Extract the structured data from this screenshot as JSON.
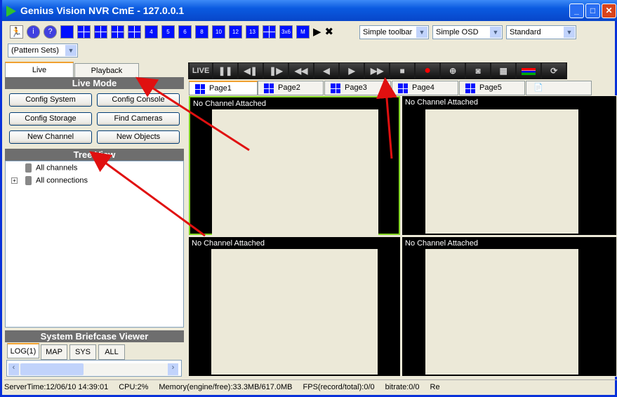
{
  "window": {
    "title": "Genius Vision NVR CmE - 127.0.0.1",
    "min": "_",
    "max": "□",
    "close": "✕"
  },
  "toolbar": {
    "icons": [
      "exit-icon",
      "info-icon",
      "help-icon",
      "layout-1",
      "layout-4",
      "layout-9",
      "layout-16",
      "layout-25",
      "layout-4-plus",
      "layout-5",
      "layout-6",
      "layout-8",
      "layout-10",
      "layout-12",
      "layout-13",
      "layout-7",
      "layout-3x6",
      "layout-m"
    ],
    "layout_labels": {
      "l4p": "4",
      "l5": "5",
      "l6": "6",
      "l8": "8",
      "l10": "10",
      "l12": "12",
      "l13": "13",
      "l3x6": "3x6",
      "lm": "M"
    },
    "play": "▶",
    "stop": "✖",
    "toolbar_select": "Simple toolbar",
    "osd_select": "Simple OSD",
    "mode_select": "Standard",
    "pattern_select": "(Pattern Sets)"
  },
  "left": {
    "tabs": [
      "Live",
      "Playback"
    ],
    "live_mode": "Live Mode",
    "buttons": [
      "Config System",
      "Config Console",
      "Config Storage",
      "Find Cameras",
      "New Channel",
      "New Objects"
    ],
    "tree_view": "Tree View",
    "tree": [
      "All channels",
      "All connections"
    ],
    "briefcase": "System Briefcase Viewer",
    "briefcase_tabs": [
      "LOG(1)",
      "MAP",
      "SYS",
      "ALL"
    ]
  },
  "controls": {
    "live": "LIVE",
    "buttons": [
      "pause",
      "step-back",
      "step-forward",
      "rewind",
      "reverse",
      "play",
      "fast-forward",
      "stop",
      "record",
      "zoom",
      "snapshot",
      "grid",
      "color",
      "refresh"
    ]
  },
  "pages": [
    "Page1",
    "Page2",
    "Page3",
    "Page4",
    "Page5"
  ],
  "cells": [
    "No Channel Attached",
    "No Channel Attached",
    "No Channel Attached",
    "No Channel Attached"
  ],
  "status": {
    "server_time": "ServerTime:12/06/10 14:39:01",
    "cpu": "CPU:2%",
    "memory": "Memory(engine/free):33.3MB/617.0MB",
    "fps": "FPS(record/total):0/0",
    "bitrate": "bitrate:0/0",
    "re": "Re"
  },
  "colors": {
    "accent": "#0010ff",
    "active_cell": "#7fd21f",
    "arrow": "#e01010"
  }
}
